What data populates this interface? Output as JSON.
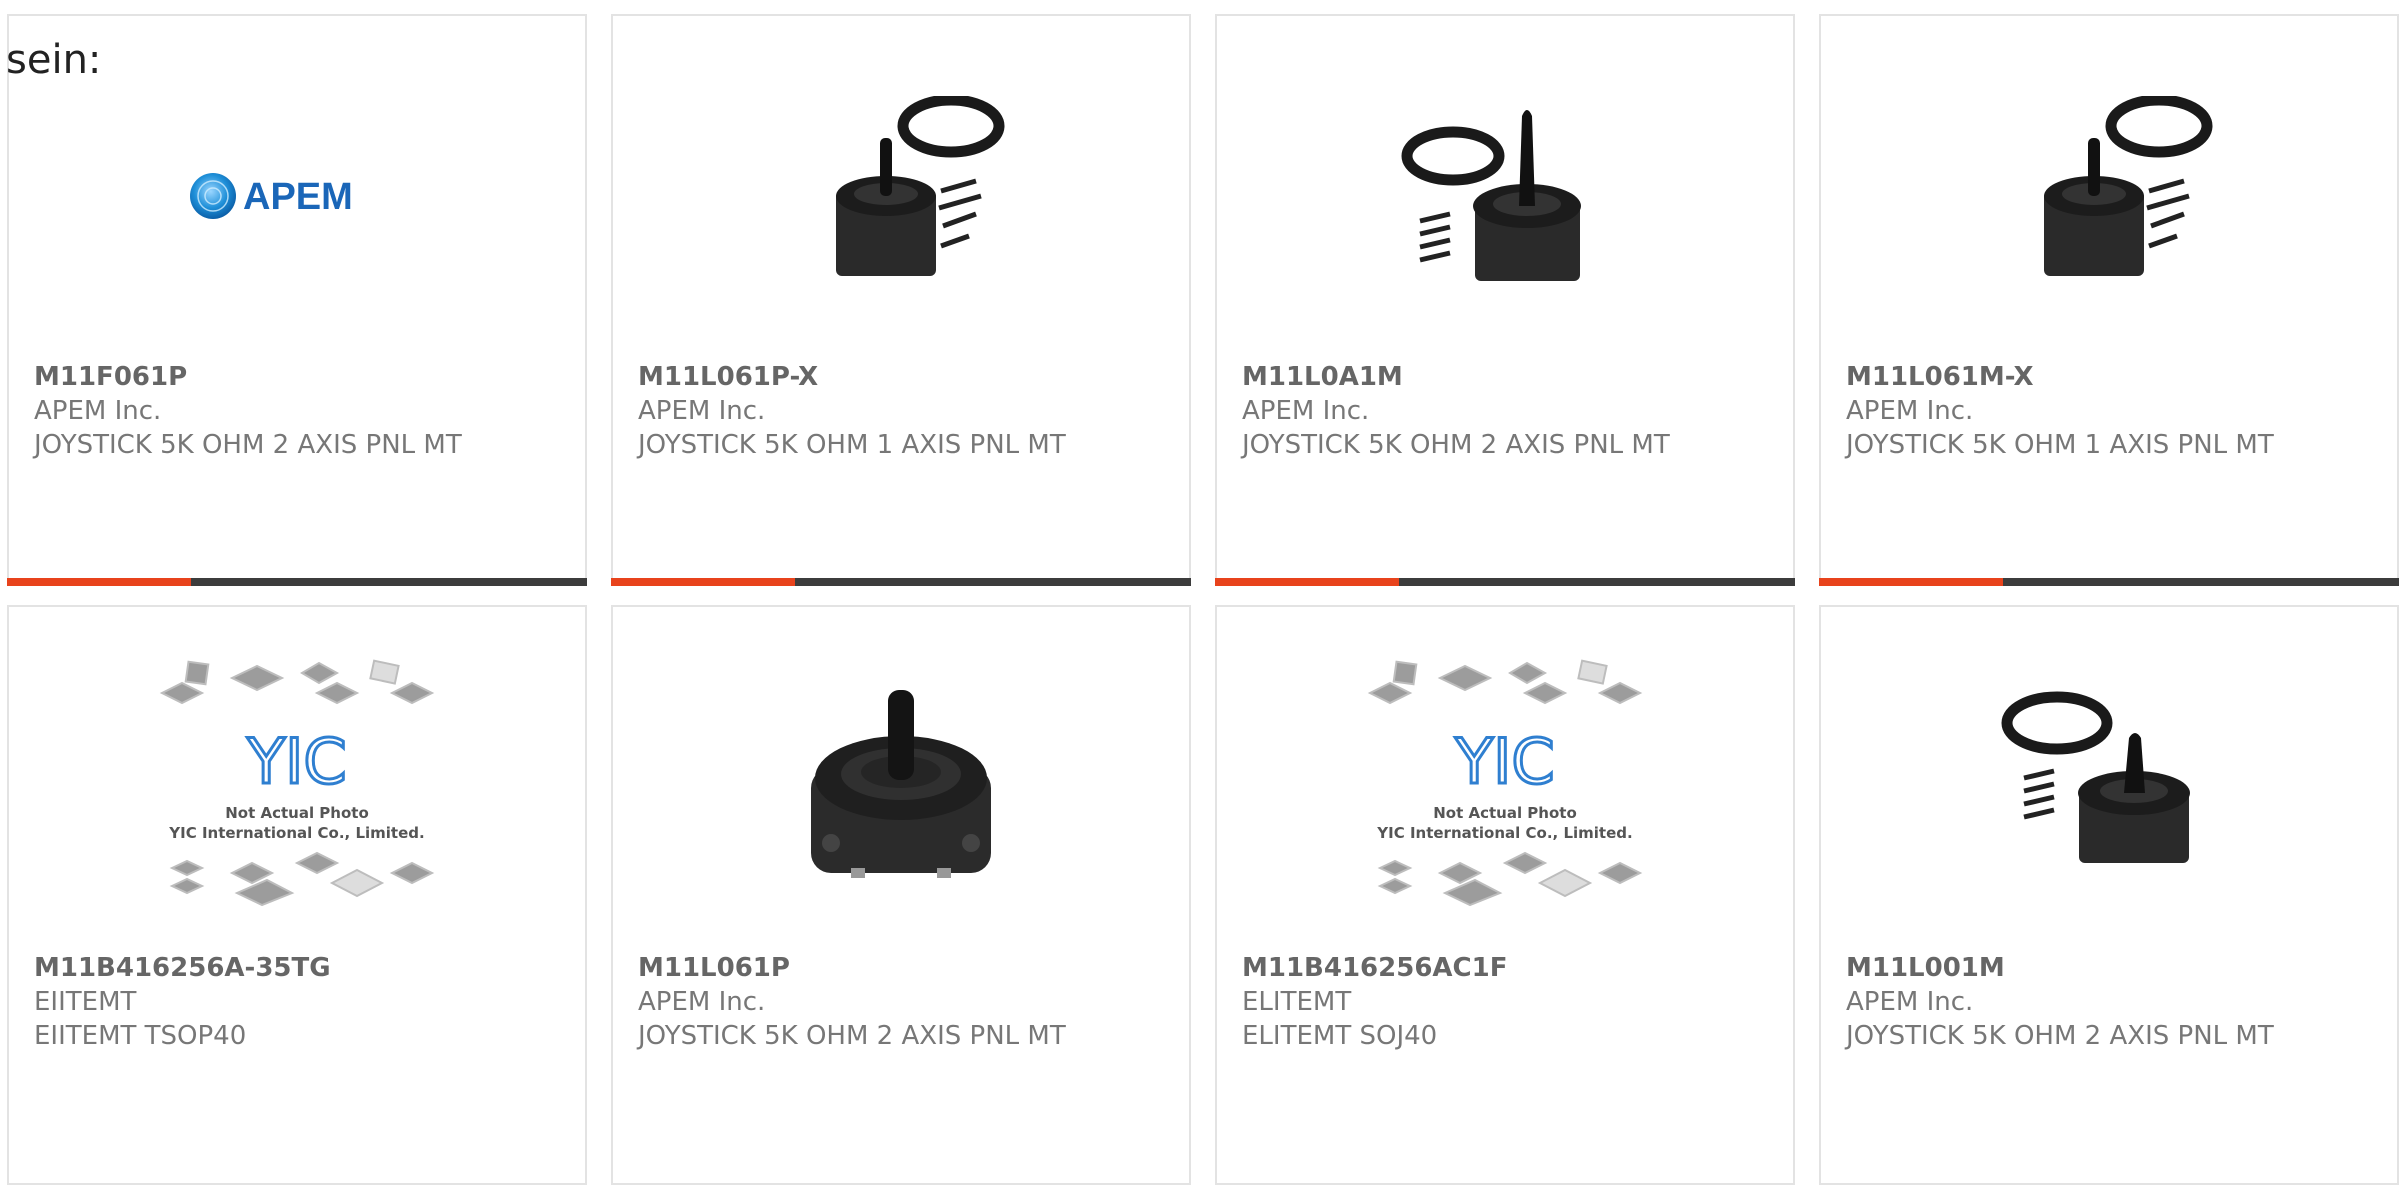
{
  "intro_text": "sein:",
  "colors": {
    "accent": "#e8431c",
    "bar": "#3c3c3c",
    "apem_blue": "#1a66b8",
    "yic_blue": "#2f7fd0"
  },
  "products": [
    {
      "part": "M11F061P",
      "manufacturer": "APEM Inc.",
      "description": "JOYSTICK 5K OHM 2 AXIS PNL MT",
      "image": "apem-logo"
    },
    {
      "part": "M11L061P-X",
      "manufacturer": "APEM Inc.",
      "description": "JOYSTICK 5K OHM 1 AXIS PNL MT",
      "image": "joystick-kit-right"
    },
    {
      "part": "M11L0A1M",
      "manufacturer": "APEM Inc.",
      "description": "JOYSTICK 5K OHM 2 AXIS PNL MT",
      "image": "joystick-kit-left"
    },
    {
      "part": "M11L061M-X",
      "manufacturer": "APEM Inc.",
      "description": "JOYSTICK 5K OHM 1 AXIS PNL MT",
      "image": "joystick-kit-right"
    },
    {
      "part": "M11B416256A-35TG",
      "manufacturer": "EIITEMT",
      "description": "EIITEMT TSOP40",
      "image": "yic-placeholder"
    },
    {
      "part": "M11L061P",
      "manufacturer": "APEM Inc.",
      "description": "JOYSTICK 5K OHM 2 AXIS PNL MT",
      "image": "joystick-closeup"
    },
    {
      "part": "M11B416256AC1F",
      "manufacturer": "ELITEMT",
      "description": "ELITEMT SOJ40",
      "image": "yic-placeholder"
    },
    {
      "part": "M11L001M",
      "manufacturer": "APEM Inc.",
      "description": "JOYSTICK 5K OHM 2 AXIS PNL MT",
      "image": "joystick-kit-left"
    }
  ],
  "image_text": {
    "apem_logo": "APEM",
    "yic_logo": "YIC",
    "yic_line1": "Not Actual Photo",
    "yic_line2": "YIC International Co., Limited."
  }
}
